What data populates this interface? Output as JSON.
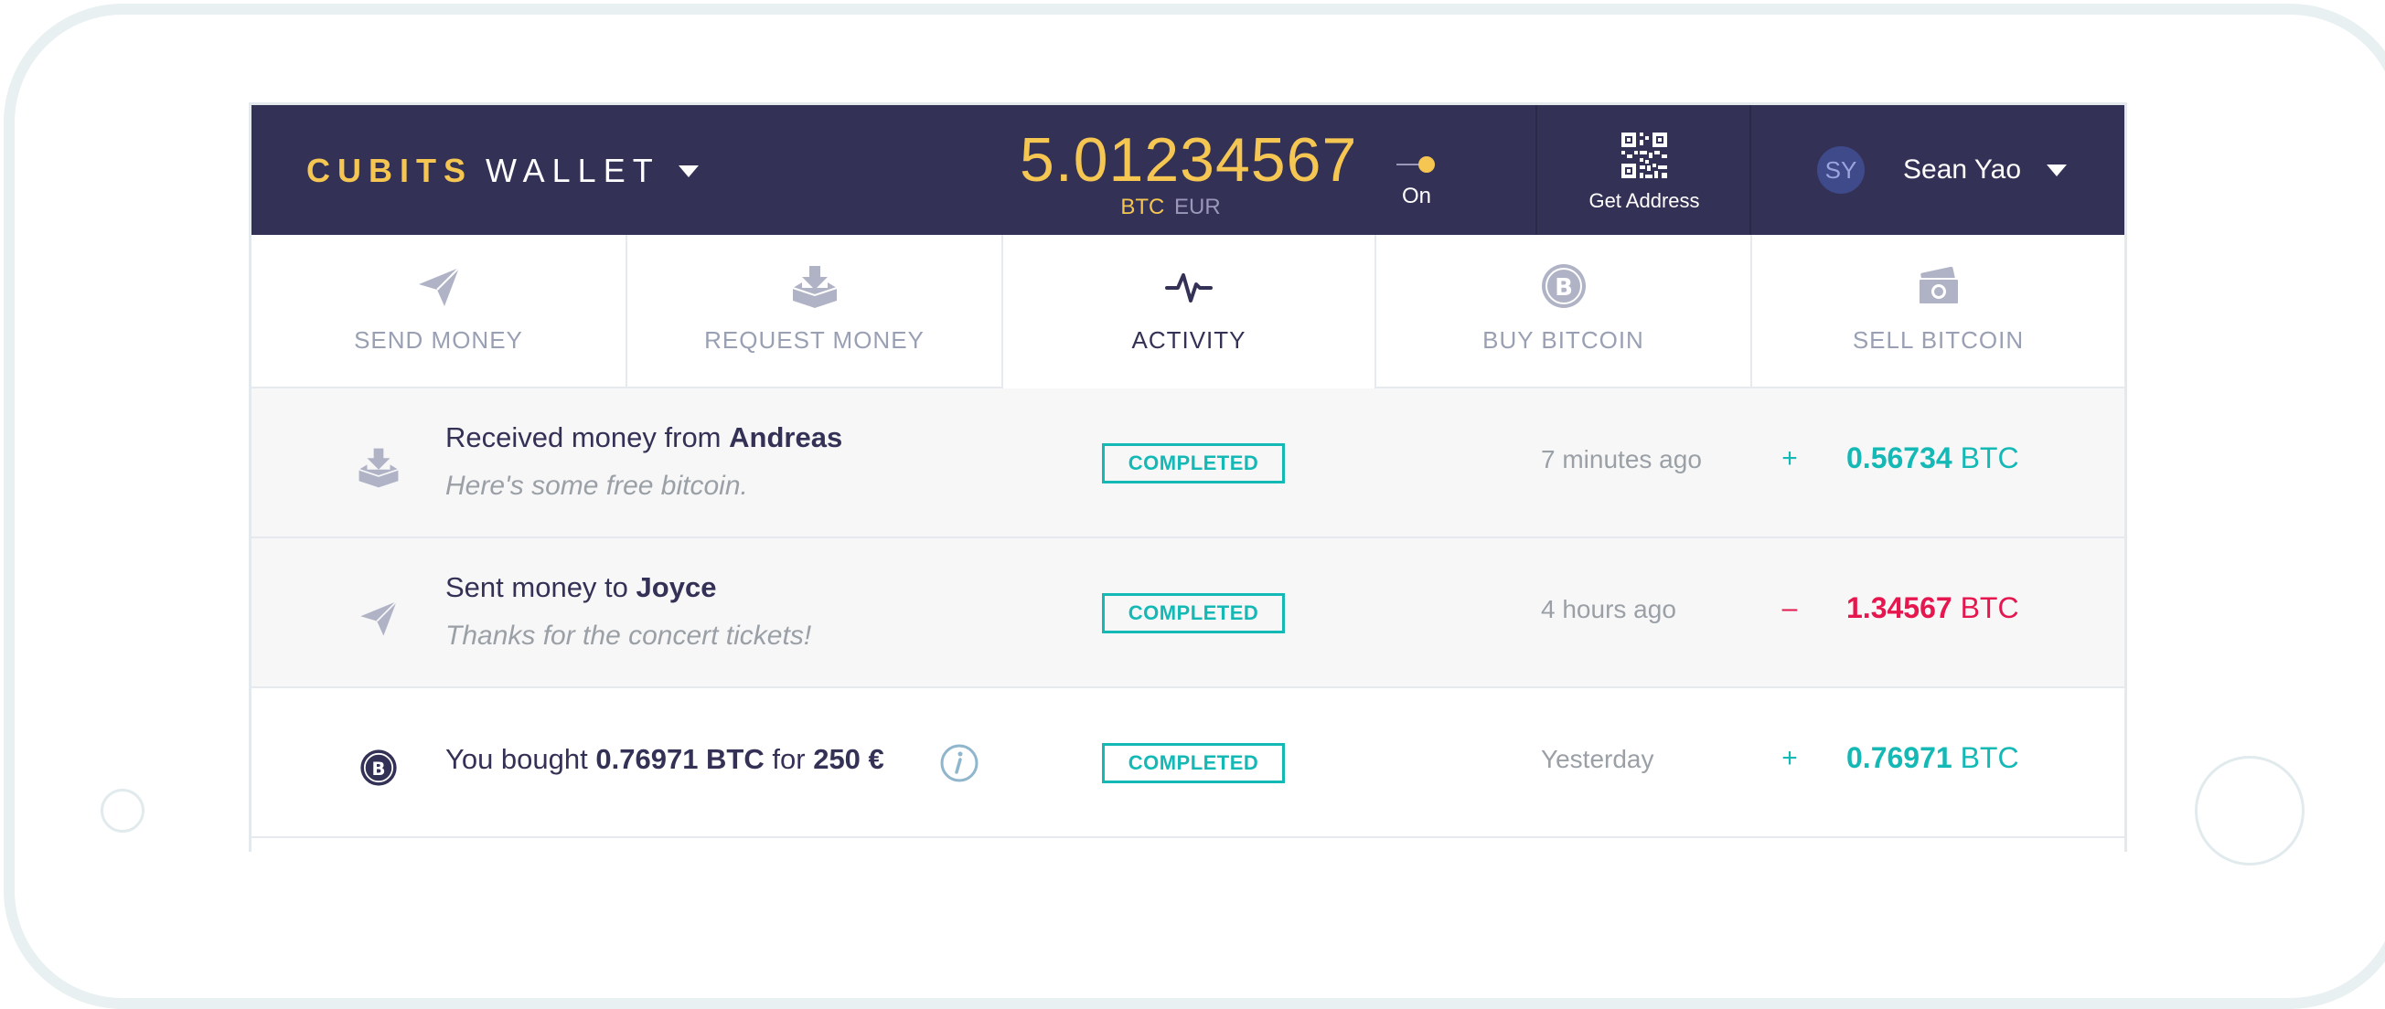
{
  "header": {
    "brand_primary": "CUBITS",
    "brand_secondary": "WALLET",
    "balance": "5.01234567",
    "unit_active": "BTC",
    "unit_inactive": "EUR",
    "toggle_label": "On",
    "get_address_label": "Get Address",
    "user_initials": "SY",
    "user_name": "Sean Yao"
  },
  "tabs": [
    {
      "label": "SEND MONEY",
      "icon": "paper-plane-icon",
      "active": false
    },
    {
      "label": "REQUEST MONEY",
      "icon": "inbox-download-icon",
      "active": false
    },
    {
      "label": "ACTIVITY",
      "icon": "activity-pulse-icon",
      "active": true
    },
    {
      "label": "BUY BITCOIN",
      "icon": "bitcoin-coin-icon",
      "active": false
    },
    {
      "label": "SELL BITCOIN",
      "icon": "cash-stack-icon",
      "active": false
    }
  ],
  "activity": [
    {
      "title_prefix": "Received money from",
      "title_name": "Andreas",
      "note": "Here's some free bitcoin.",
      "status": "COMPLETED",
      "time": "7 minutes ago",
      "sign": "+",
      "amount": "0.56734",
      "unit": "BTC"
    },
    {
      "title_prefix": "Sent money to",
      "title_name": "Joyce",
      "note": "Thanks for the concert tickets!",
      "status": "COMPLETED",
      "time": "4 hours ago",
      "sign": "–",
      "amount": "1.34567",
      "unit": "BTC"
    },
    {
      "title_prefix": "You bought",
      "title_btc": "0.76971 BTC",
      "title_mid": "for",
      "title_eur": "250 €",
      "status": "COMPLETED",
      "time": "Yesterday",
      "sign": "+",
      "amount": "0.76971",
      "unit": "BTC"
    }
  ],
  "colors": {
    "header_bg": "#343156",
    "accent_yellow": "#f5c652",
    "positive_teal": "#14b8b5",
    "negative_red": "#e5174e"
  }
}
